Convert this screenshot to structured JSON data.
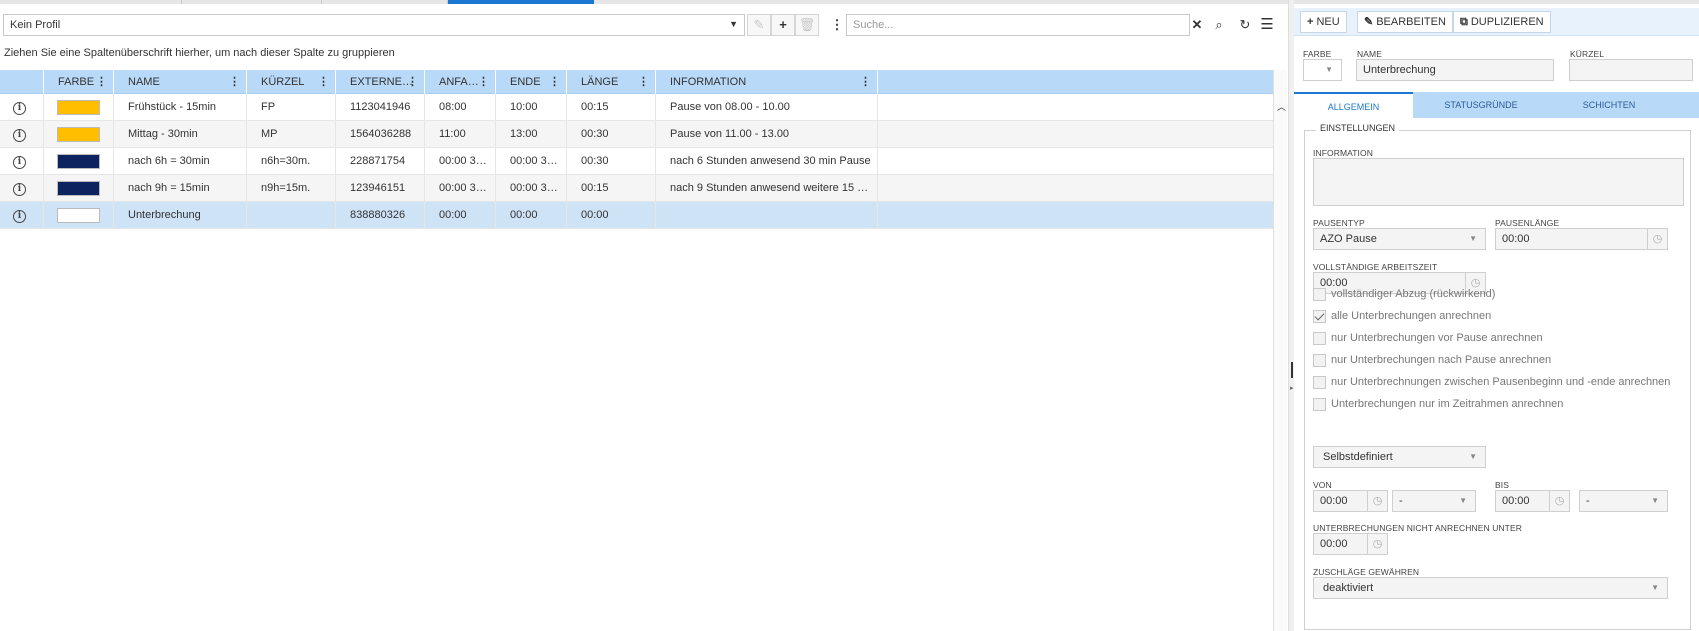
{
  "left": {
    "profile_value": "Kein Profil",
    "search_placeholder": "Suche...",
    "group_hint": "Ziehen Sie eine Spaltenüberschrift hierher, um nach dieser Spalte zu gruppieren",
    "columns": [
      "FARBE",
      "NAME",
      "KÜRZEL",
      "EXTERNE…",
      "ANFA…",
      "ENDE",
      "LÄNGE",
      "INFORMATION"
    ],
    "rows": [
      {
        "color": "#ffbf00",
        "name": "Frühstück - 15min",
        "kuerzel": "FP",
        "extern": "1123041946",
        "anfang": "08:00",
        "ende": "10:00",
        "laenge": "00:15",
        "info": "Pause von 08.00 - 10.00"
      },
      {
        "color": "#ffbf00",
        "name": "Mittag - 30min",
        "kuerzel": "MP",
        "extern": "1564036288",
        "anfang": "11:00",
        "ende": "13:00",
        "laenge": "00:30",
        "info": "Pause von 11.00 - 13.00"
      },
      {
        "color": "#0d2360",
        "name": "nach 6h = 30min",
        "kuerzel": "n6h=30m.",
        "extern": "228871754",
        "anfang": "00:00 3…",
        "ende": "00:00 3…",
        "laenge": "00:30",
        "info": "nach 6 Stunden anwesend 30 min Pause"
      },
      {
        "color": "#0d2360",
        "name": "nach 9h = 15min",
        "kuerzel": "n9h=15m.",
        "extern": "123946151",
        "anfang": "00:00 3…",
        "ende": "00:00 3…",
        "laenge": "00:15",
        "info": "nach 9 Stunden anwesend weitere 15 …"
      },
      {
        "color": "#ffffff",
        "name": "Unterbrechung",
        "kuerzel": "",
        "extern": "838880326",
        "anfang": "00:00",
        "ende": "00:00",
        "laenge": "00:00",
        "info": ""
      }
    ]
  },
  "right": {
    "buttons": {
      "new": "NEU",
      "edit": "BEARBEITEN",
      "duplicate": "DUPLIZIEREN"
    },
    "labels": {
      "farbe": "FARBE",
      "name": "NAME",
      "kuerzel": "KÜRZEL"
    },
    "name_value": "Unterbrechung",
    "kuerzel_value": "",
    "tabs": [
      "ALLGEMEIN",
      "STATUSGRÜNDE",
      "SCHICHTEN"
    ],
    "settings_legend": "EINSTELLUNGEN",
    "information_label": "INFORMATION",
    "pausentyp_label": "PAUSENTYP",
    "pausentyp_value": "AZO Pause",
    "pausenlaenge_label": "PAUSENLÄNGE",
    "pausenlaenge_value": "00:00",
    "vollst_label": "VOLLSTÄNDIGE ARBEITSZEIT",
    "vollst_value": "00:00",
    "checkboxes": [
      {
        "label": "vollständiger Abzug (rückwirkend)",
        "checked": false
      },
      {
        "label": "alle Unterbrechungen anrechnen",
        "checked": true
      },
      {
        "label": "nur Unterbrechungen vor Pause anrechnen",
        "checked": false
      },
      {
        "label": "nur Unterbrechungen nach Pause anrechnen",
        "checked": false
      },
      {
        "label": "nur Unterbrechnungen zwischen Pausenbeginn und -ende anrechnen",
        "checked": false
      },
      {
        "label": "Unterbrechungen nur im Zeitrahmen anrechnen",
        "checked": false
      }
    ],
    "zeitrahmen_value": "Selbstdefiniert",
    "von_label": "VON",
    "von_time": "00:00",
    "von_select": "-",
    "bis_label": "BIS",
    "bis_time": "00:00",
    "bis_select": "-",
    "nicht_anrechnen_label": "UNTERBRECHUNGEN NICHT ANRECHNEN UNTER",
    "nicht_anrechnen_value": "00:00",
    "zuschlaege_label": "ZUSCHLÄGE GEWÄHREN",
    "zuschlaege_value": "deaktiviert"
  }
}
